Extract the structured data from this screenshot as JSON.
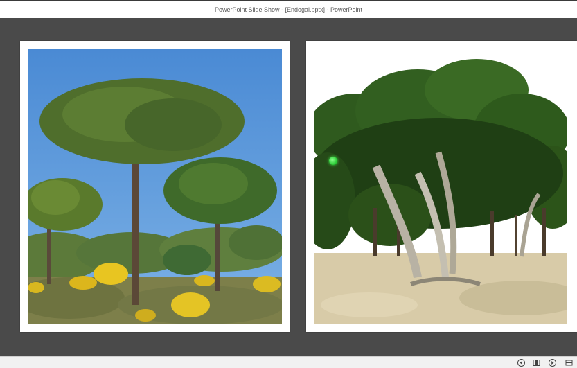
{
  "window": {
    "title": "PowerPoint Slide Show - [Endogal.pptx] - PowerPoint"
  },
  "slide": {
    "left_image_icon": "stone-pine-trees-photo",
    "right_image_icon": "pine-forest-photo"
  },
  "pointer": {
    "icon": "laser-pointer-dot",
    "color": "#2fcf3a"
  },
  "statusbar": {
    "prev_icon": "previous-slide-icon",
    "menu_icon": "slide-menu-icon",
    "next_icon": "next-slide-icon",
    "view_icon": "view-options-icon"
  },
  "colors": {
    "background": "#4a4a4a",
    "frame": "#ffffff",
    "sky": "#5b97d6"
  }
}
